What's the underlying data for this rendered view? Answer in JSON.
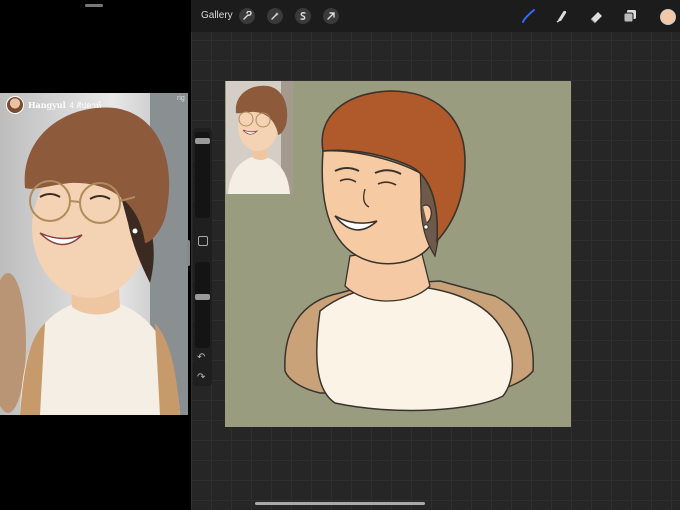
{
  "story": {
    "username": "Hangyul",
    "date": "4 สัปดาห์",
    "corner_text": "rig"
  },
  "procreate": {
    "gallery_label": "Gallery",
    "tools_left": [
      "wrench-icon",
      "magic-wand-icon",
      "selection-icon",
      "transform-arrow-icon"
    ],
    "tools_right": [
      "brush-icon",
      "smudge-icon",
      "eraser-icon",
      "layers-icon"
    ],
    "active_tool": "brush",
    "colors": {
      "current_color": "#f2c8a6",
      "canvas_background": "#9a9c80",
      "brush_accent": "#2f6bff"
    },
    "sidebar": {
      "brush_size": 0.92,
      "brush_opacity": 0.6
    }
  }
}
